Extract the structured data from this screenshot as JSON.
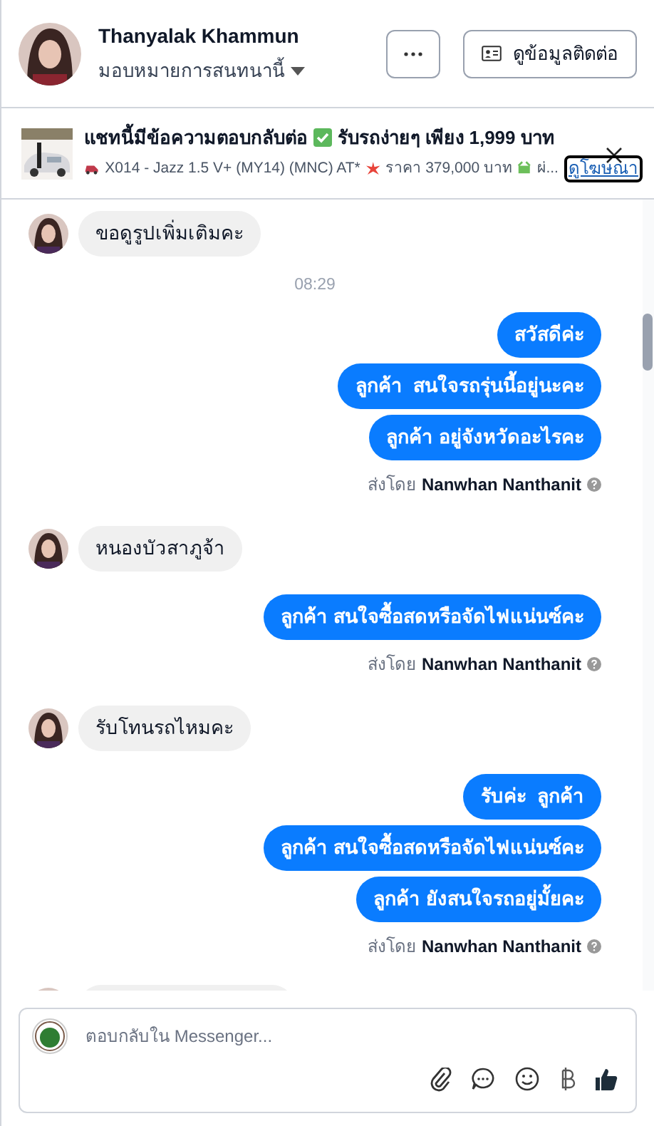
{
  "header": {
    "name": "Thanyalak Khammun",
    "assign": "มอบหมายการสนทนานี้",
    "contact_button": "ดูข้อมูลติดต่อ"
  },
  "ad": {
    "title_start": "แชทนี้มีข้อความตอบกลับต่อ",
    "title_end": "รับรถง่ายๆ เพียง 1,999 บาท",
    "model": "X014 - Jazz 1.5 V+ (MY14) (MNC) AT*",
    "price": "ราคา 379,000 บาท",
    "rest": "ผ่...",
    "link": "ดูโฆษณา"
  },
  "messages": [
    {
      "kind": "incoming",
      "text": "ขอดูรูปเพิ่มเติมคะ"
    },
    {
      "kind": "time",
      "text": "08:29"
    },
    {
      "kind": "outgoing",
      "bubbles": [
        "สวัสดีค่ะ",
        "ลูกค้า  สนใจรถรุ่นนี้อยู่นะคะ",
        "ลูกค้า อยู่จังหวัดอะไรคะ"
      ],
      "sent_by": "ส่งโดย",
      "sender": "Nanwhan Nanthanit"
    },
    {
      "kind": "incoming",
      "text": "หนองบัวสาภูจ้า"
    },
    {
      "kind": "outgoing",
      "bubbles": [
        "ลูกค้า สนใจซื้อสดหรือจัดไฟแน่นซ์คะ"
      ],
      "sent_by": "ส่งโดย",
      "sender": "Nanwhan Nanthanit"
    },
    {
      "kind": "incoming",
      "text": "รับโทนรถไหมคะ"
    },
    {
      "kind": "outgoing",
      "bubbles": [
        "รับค่ะ  ลูกค้า",
        "ลูกค้า สนใจซื้อสดหรือจัดไฟแน่นซ์คะ",
        "ลูกค้า ยังสนใจรถอยู่มั้ยคะ"
      ],
      "sent_by": "ส่งโดย",
      "sender": "Nanwhan Nanthanit"
    }
  ],
  "composer": {
    "placeholder": "ตอบกลับใน Messenger..."
  }
}
